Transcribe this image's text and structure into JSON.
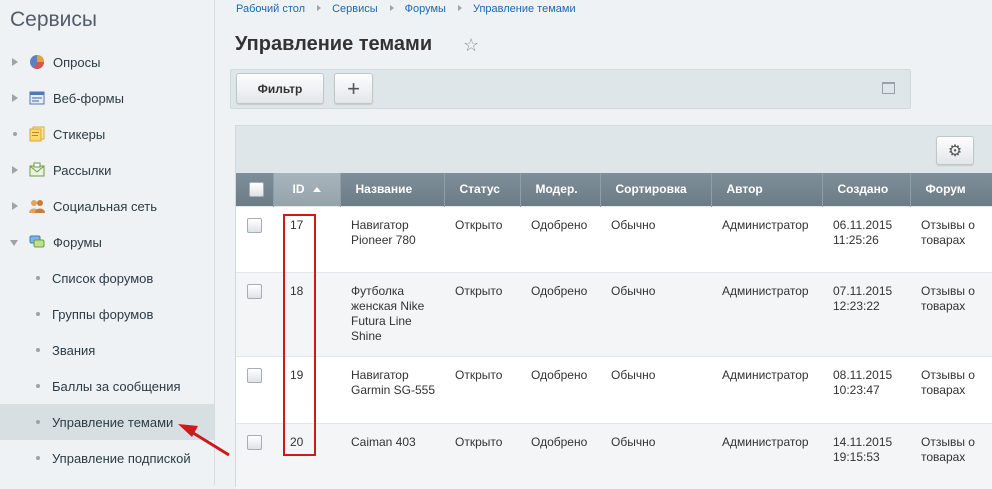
{
  "sidebar": {
    "title": "Сервисы",
    "items": [
      {
        "label": "Опросы",
        "icon": "poll-icon",
        "expanded": false
      },
      {
        "label": "Веб-формы",
        "icon": "web-form-icon",
        "expanded": false
      },
      {
        "label": "Стикеры",
        "icon": "sticker-icon",
        "expanded": false
      },
      {
        "label": "Рассылки",
        "icon": "mailing-icon",
        "expanded": false
      },
      {
        "label": "Социальная сеть",
        "icon": "social-network-icon",
        "expanded": false
      },
      {
        "label": "Форумы",
        "icon": "forum-icon",
        "expanded": true
      }
    ],
    "sub_items": [
      {
        "label": "Список форумов"
      },
      {
        "label": "Группы форумов"
      },
      {
        "label": "Звания"
      },
      {
        "label": "Баллы за сообщения"
      },
      {
        "label": "Управление темами",
        "active": true
      },
      {
        "label": "Управление подпиской"
      }
    ]
  },
  "breadcrumb": [
    "Рабочий стол",
    "Сервисы",
    "Форумы",
    "Управление темами"
  ],
  "page": {
    "title": "Управление темами",
    "favorite_icon": "star-icon"
  },
  "toolbar": {
    "filter_label": "Фильтр",
    "add_label": "+",
    "add_icon": "plus-icon",
    "settings_icon": "gear-icon",
    "collapse_icon": "window-icon"
  },
  "table": {
    "columns": [
      "ID",
      "Название",
      "Статус",
      "Модер.",
      "Сортировка",
      "Автор",
      "Создано",
      "Форум"
    ],
    "sorted_column": "ID",
    "sort_direction": "ascending",
    "rows": [
      {
        "id": "17",
        "name": "Навигатор Pioneer 780",
        "status": "Открыто",
        "moderation": "Одобрено",
        "sort": "Обычно",
        "author": "Администратор",
        "created": "06.11.2015 11:25:26",
        "forum": "Отзывы о товарах"
      },
      {
        "id": "18",
        "name": "Футболка женская Nike Futura Line Shine",
        "status": "Открыто",
        "moderation": "Одобрено",
        "sort": "Обычно",
        "author": "Администратор",
        "created": "07.11.2015 12:23:22",
        "forum": "Отзывы о товарах"
      },
      {
        "id": "19",
        "name": "Навигатор Garmin SG-555",
        "status": "Открыто",
        "moderation": "Одобрено",
        "sort": "Обычно",
        "author": "Администратор",
        "created": "08.11.2015 10:23:47",
        "forum": "Отзывы о товарах"
      },
      {
        "id": "20",
        "name": "Caiman 403",
        "status": "Открыто",
        "moderation": "Одобрено",
        "sort": "Обычно",
        "author": "Администратор",
        "created": "14.11.2015 19:15:53",
        "forum": "Отзывы о товарах"
      }
    ]
  },
  "annotation": {
    "color": "#cc1a1a"
  }
}
